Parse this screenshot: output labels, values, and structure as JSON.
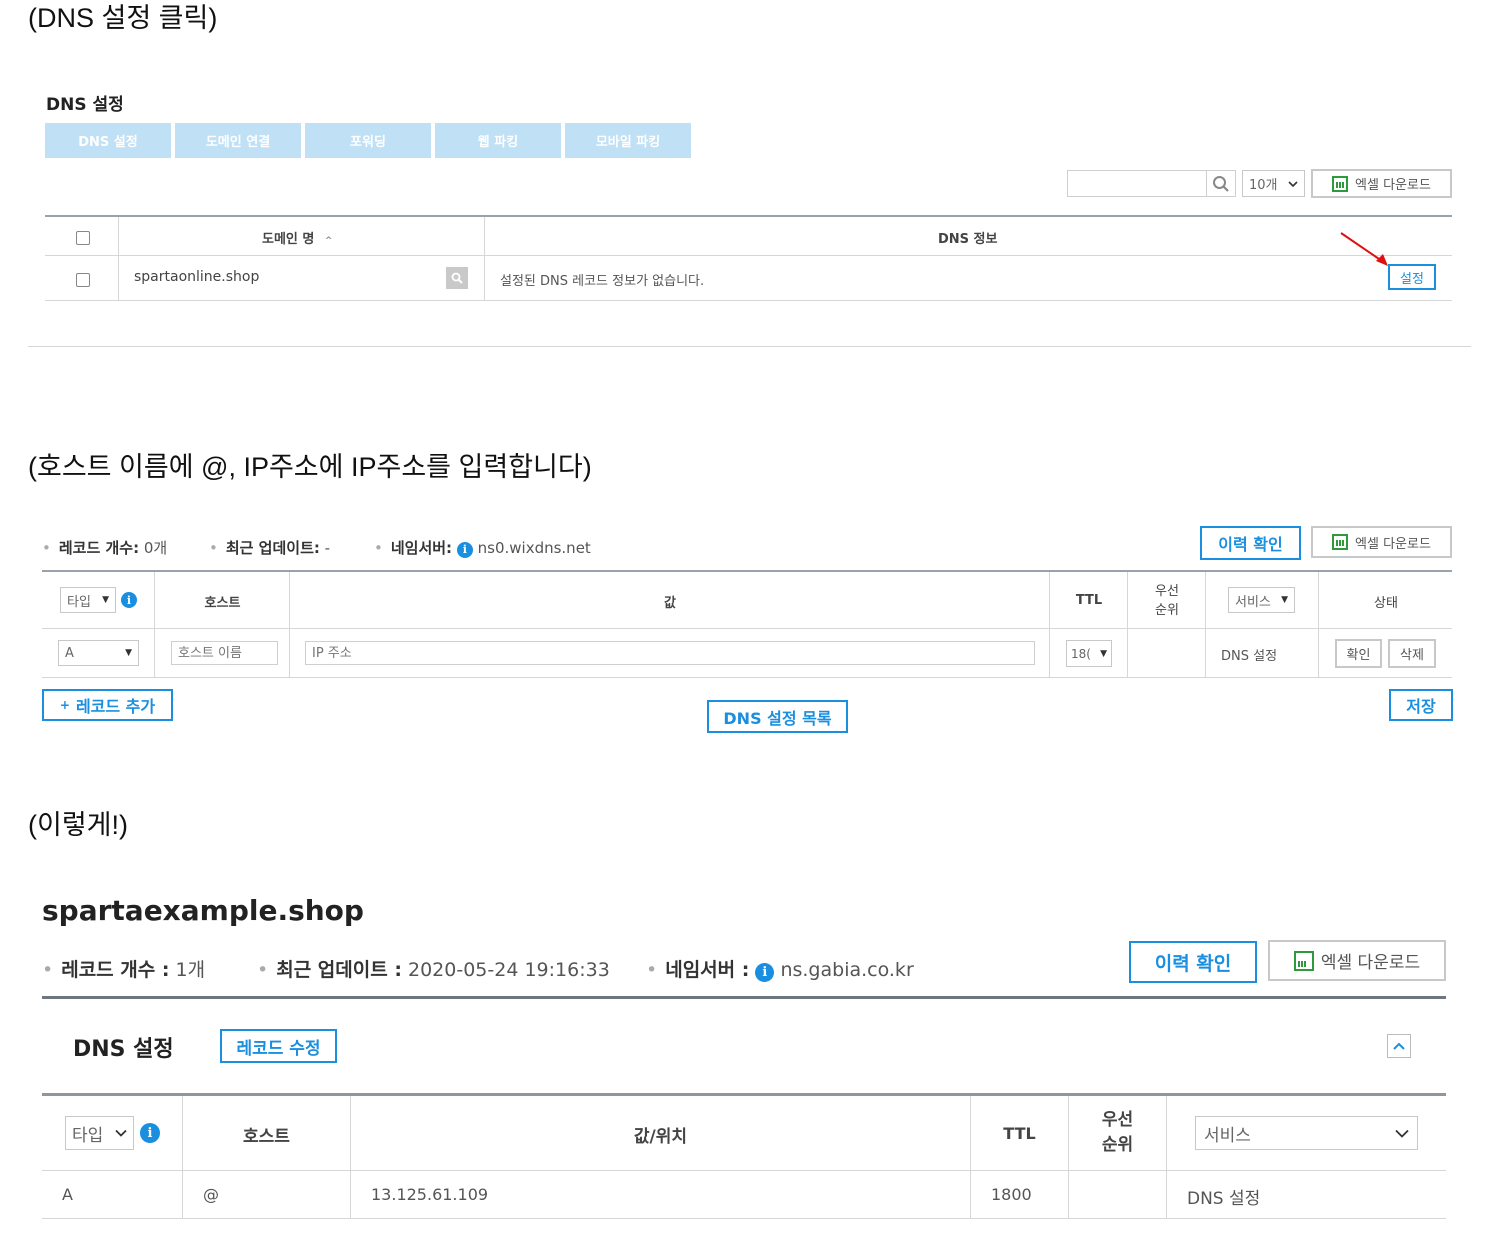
{
  "captions": {
    "c1": "(DNS 설정 클릭)",
    "c2": "(호스트 이름에 @, IP주소에 IP주소를 입력합니다)",
    "c3": "(이렇게!)"
  },
  "panel1": {
    "title": "DNS 설정",
    "tabs": [
      "DNS 설정",
      "도메인 연결",
      "포워딩",
      "웹 파킹",
      "모바일 파킹"
    ],
    "page_size": "10개",
    "excel_label": "엑셀 다운로드",
    "col_domain": "도메인 명",
    "sort_glyph": "^",
    "col_dns": "DNS 정보",
    "row_domain": "spartaonline.shop",
    "row_info": "설정된 DNS 레코드 정보가 없습니다.",
    "set_label": "설정"
  },
  "panel2": {
    "record_count_label": "레코드 개수:",
    "record_count": "0개",
    "updated_label": "최근 업데이트:",
    "updated": "-",
    "ns_label": "네임서버:",
    "ns": "ns0.wixdns.net",
    "history_label": "이력 확인",
    "excel_label": "엑셀 다운로드",
    "col_type": "타입",
    "col_host": "호스트",
    "col_value": "값",
    "col_ttl": "TTL",
    "col_priority_1": "우선",
    "col_priority_2": "순위",
    "col_service": "서비스",
    "col_status": "상태",
    "row_type": "A",
    "host_placeholder": "호스트 이름",
    "ip_placeholder": "IP 주소",
    "ttl_value": "18(",
    "service_value": "DNS 설정",
    "confirm_label": "확인",
    "delete_label": "삭제",
    "add_label": "레코드 추가",
    "add_glyph": "+",
    "list_label": "DNS 설정 목록",
    "save_label": "저장",
    "info_glyph": "i"
  },
  "panel3": {
    "domain": "spartaexample.shop",
    "record_count_label": "레코드 개수 :",
    "record_count": "1개",
    "updated_label": "최근 업데이트 :",
    "updated": "2020-05-24 19:16:33",
    "ns_label": "네임서버 :",
    "ns": "ns.gabia.co.kr",
    "history_label": "이력 확인",
    "excel_label": "엑셀 다운로드",
    "section_title": "DNS 설정",
    "edit_label": "레코드 수정",
    "col_type": "타입",
    "col_host": "호스트",
    "col_value": "값/위치",
    "col_ttl": "TTL",
    "col_priority_1": "우선",
    "col_priority_2": "순위",
    "col_service": "서비스",
    "row": {
      "type": "A",
      "host": "@",
      "value": "13.125.61.109",
      "ttl": "1800",
      "service": "DNS 설정"
    }
  },
  "colors": {
    "accent": "#1a8fe0",
    "tab_bg": "#bfe0f5",
    "arrow": "#e01010"
  }
}
